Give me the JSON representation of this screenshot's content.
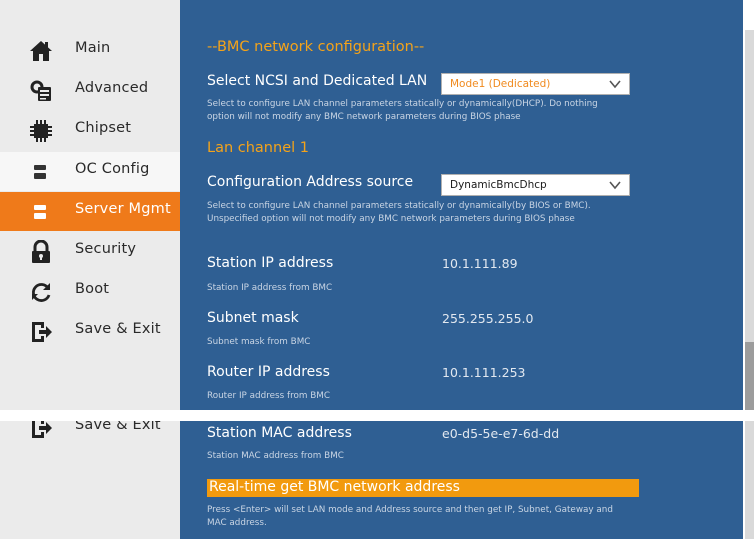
{
  "sidebar": {
    "items": [
      {
        "label": "Main",
        "icon": "home-icon"
      },
      {
        "label": "Advanced",
        "icon": "advanced-icon"
      },
      {
        "label": "Chipset",
        "icon": "chip-icon"
      },
      {
        "label": "OC Config",
        "icon": "oc-config-icon"
      },
      {
        "label": "Server Mgmt",
        "icon": "server-icon"
      },
      {
        "label": "Security",
        "icon": "lock-icon"
      },
      {
        "label": "Boot",
        "icon": "boot-icon"
      },
      {
        "label": "Save & Exit",
        "icon": "exit-icon"
      }
    ],
    "active_index": 4,
    "hover_index": 3,
    "bottom_label": "Save & Exit"
  },
  "content": {
    "section_title": "--BMC network configuration--",
    "ncsi": {
      "label": "Select NCSI and Dedicated LAN",
      "value": "Mode1 (Dedicated)",
      "help": "Select to configure LAN channel parameters statically or dynamically(DHCP). Do nothing option will not modify any BMC network parameters during BIOS phase"
    },
    "lan_channel_title": "Lan channel 1",
    "config_source": {
      "label": "Configuration Address source",
      "value": "DynamicBmcDhcp",
      "help": "Select to configure LAN channel parameters statically or dynamically(by BIOS or BMC). Unspecified option will not modify any BMC network parameters during BIOS phase"
    },
    "station_ip": {
      "label": "Station IP address",
      "value": "10.1.111.89",
      "help": "Station IP address from BMC"
    },
    "subnet": {
      "label": "Subnet mask",
      "value": "255.255.255.0",
      "help": "Subnet mask from BMC"
    },
    "router_ip": {
      "label": "Router IP address",
      "value": "10.1.111.253",
      "help": "Router IP address from BMC"
    },
    "station_mac": {
      "label": "Station MAC address",
      "value": "e0-d5-5e-e7-6d-dd",
      "help": "Station MAC address from BMC"
    },
    "realtime": {
      "label": "Real-time get BMC network address",
      "help": "Press <Enter> will set LAN mode and Address source and then get IP, Subnet, Gateway and MAC address."
    }
  },
  "colors": {
    "accent": "#ef7a1a",
    "content_bg": "#2f5f93",
    "heading": "#f4a31a",
    "highlight": "#f29a0e"
  }
}
